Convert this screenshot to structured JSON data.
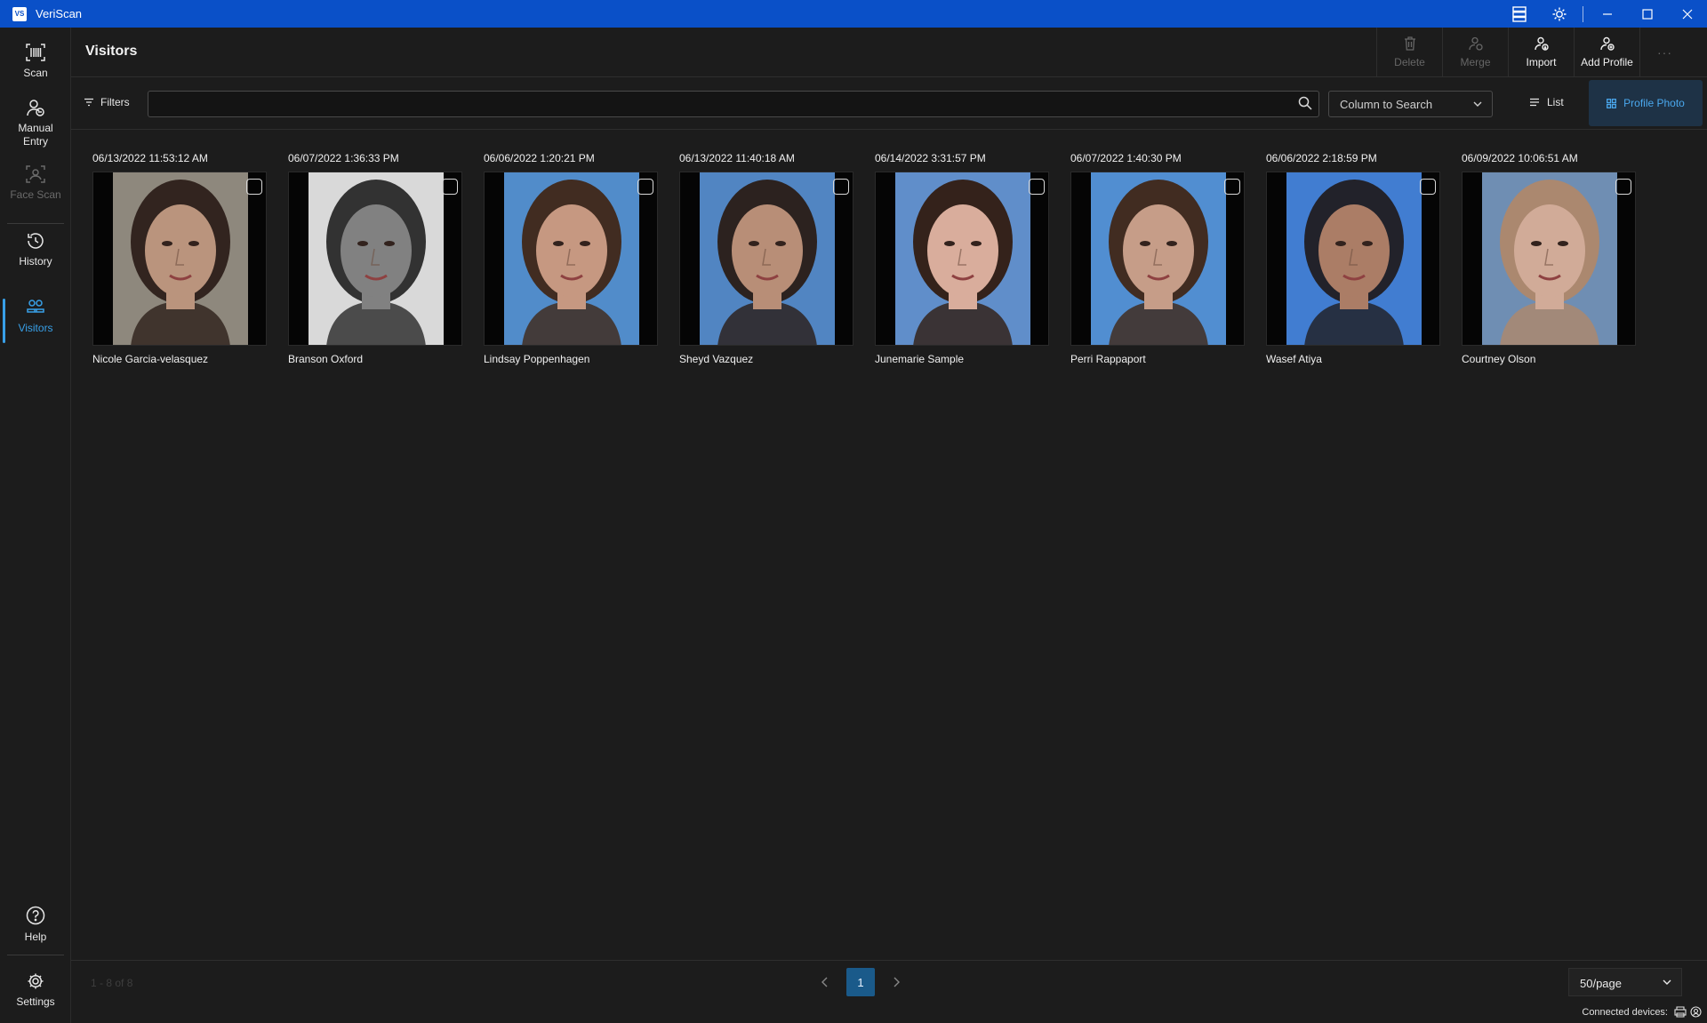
{
  "window": {
    "logo_text": "VS",
    "title": "VeriScan"
  },
  "sidebar": {
    "items": [
      {
        "label": "Scan",
        "icon": "barcode-scan-icon"
      },
      {
        "label": "Manual Entry",
        "icon": "add-user-icon"
      },
      {
        "label": "Face Scan",
        "icon": "face-scan-icon",
        "disabled": true
      },
      {
        "label": "History",
        "icon": "history-icon"
      },
      {
        "label": "Visitors",
        "icon": "visitors-icon",
        "active": true
      },
      {
        "label": "Help",
        "icon": "help-icon"
      },
      {
        "label": "Settings",
        "icon": "gear-icon"
      }
    ]
  },
  "header": {
    "title": "Visitors",
    "actions": {
      "delete": "Delete",
      "merge": "Merge",
      "import": "Import",
      "add_profile": "Add Profile",
      "more": "···"
    }
  },
  "toolbar": {
    "filters_label": "Filters",
    "search_value": "",
    "column_select": "Column to Search",
    "view_list": "List",
    "view_photo": "Profile Photo"
  },
  "visitors": [
    {
      "date": "06/13/2022 11:53:12 AM",
      "name": "Nicole Garcia-velasquez",
      "bg": "#8a8478",
      "skin": "#b89078",
      "hair": "#2a1c16"
    },
    {
      "date": "06/07/2022 1:36:33 PM",
      "name": "Branson Oxford",
      "bg": "#d8d8d8",
      "skin": "#7c7c7c",
      "hair": "#2a2a2a"
    },
    {
      "date": "06/06/2022 1:20:21 PM",
      "name": "Lindsay Poppenhagen",
      "bg": "#4a88c8",
      "skin": "#c4947c",
      "hair": "#3a2418"
    },
    {
      "date": "06/13/2022 11:40:18 AM",
      "name": "Sheyd Vazquez",
      "bg": "#4a80c0",
      "skin": "#b68a72",
      "hair": "#241a16"
    },
    {
      "date": "06/14/2022 3:31:57 PM",
      "name": "Junemarie Sample",
      "bg": "#5a8ac8",
      "skin": "#d8aa98",
      "hair": "#2c1a12"
    },
    {
      "date": "06/07/2022 1:40:30 PM",
      "name": "Perri Rappaport",
      "bg": "#4a8ad0",
      "skin": "#c49a84",
      "hair": "#3a2418"
    },
    {
      "date": "06/06/2022 2:18:59 PM",
      "name": "Wasef Atiya",
      "bg": "#3a78d0",
      "skin": "#a87860",
      "hair": "#1a1a22"
    },
    {
      "date": "06/09/2022 10:06:51 AM",
      "name": "Courtney Olson",
      "bg": "#6a8ab0",
      "skin": "#d0a894",
      "hair": "#a8846a"
    }
  ],
  "footer": {
    "count": "1 - 8 of 8",
    "current_page": "1",
    "page_size": "50/page",
    "connected_label": "Connected devices:"
  },
  "colors": {
    "titlebar": "#0a50c8",
    "accent": "#38a0e8",
    "background": "#1c1c1c"
  }
}
